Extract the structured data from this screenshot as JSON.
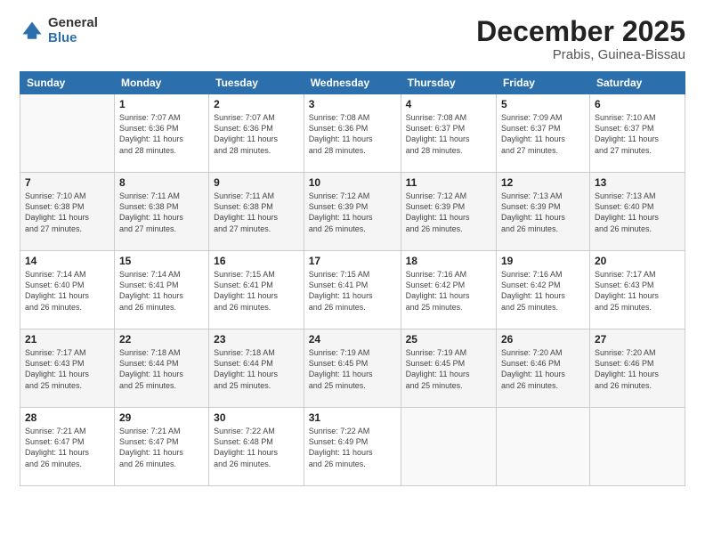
{
  "logo": {
    "general": "General",
    "blue": "Blue"
  },
  "title": "December 2025",
  "location": "Prabis, Guinea-Bissau",
  "days_of_week": [
    "Sunday",
    "Monday",
    "Tuesday",
    "Wednesday",
    "Thursday",
    "Friday",
    "Saturday"
  ],
  "weeks": [
    [
      {
        "day": "",
        "info": ""
      },
      {
        "day": "1",
        "info": "Sunrise: 7:07 AM\nSunset: 6:36 PM\nDaylight: 11 hours\nand 28 minutes."
      },
      {
        "day": "2",
        "info": "Sunrise: 7:07 AM\nSunset: 6:36 PM\nDaylight: 11 hours\nand 28 minutes."
      },
      {
        "day": "3",
        "info": "Sunrise: 7:08 AM\nSunset: 6:36 PM\nDaylight: 11 hours\nand 28 minutes."
      },
      {
        "day": "4",
        "info": "Sunrise: 7:08 AM\nSunset: 6:37 PM\nDaylight: 11 hours\nand 28 minutes."
      },
      {
        "day": "5",
        "info": "Sunrise: 7:09 AM\nSunset: 6:37 PM\nDaylight: 11 hours\nand 27 minutes."
      },
      {
        "day": "6",
        "info": "Sunrise: 7:10 AM\nSunset: 6:37 PM\nDaylight: 11 hours\nand 27 minutes."
      }
    ],
    [
      {
        "day": "7",
        "info": "Sunrise: 7:10 AM\nSunset: 6:38 PM\nDaylight: 11 hours\nand 27 minutes."
      },
      {
        "day": "8",
        "info": "Sunrise: 7:11 AM\nSunset: 6:38 PM\nDaylight: 11 hours\nand 27 minutes."
      },
      {
        "day": "9",
        "info": "Sunrise: 7:11 AM\nSunset: 6:38 PM\nDaylight: 11 hours\nand 27 minutes."
      },
      {
        "day": "10",
        "info": "Sunrise: 7:12 AM\nSunset: 6:39 PM\nDaylight: 11 hours\nand 26 minutes."
      },
      {
        "day": "11",
        "info": "Sunrise: 7:12 AM\nSunset: 6:39 PM\nDaylight: 11 hours\nand 26 minutes."
      },
      {
        "day": "12",
        "info": "Sunrise: 7:13 AM\nSunset: 6:39 PM\nDaylight: 11 hours\nand 26 minutes."
      },
      {
        "day": "13",
        "info": "Sunrise: 7:13 AM\nSunset: 6:40 PM\nDaylight: 11 hours\nand 26 minutes."
      }
    ],
    [
      {
        "day": "14",
        "info": "Sunrise: 7:14 AM\nSunset: 6:40 PM\nDaylight: 11 hours\nand 26 minutes."
      },
      {
        "day": "15",
        "info": "Sunrise: 7:14 AM\nSunset: 6:41 PM\nDaylight: 11 hours\nand 26 minutes."
      },
      {
        "day": "16",
        "info": "Sunrise: 7:15 AM\nSunset: 6:41 PM\nDaylight: 11 hours\nand 26 minutes."
      },
      {
        "day": "17",
        "info": "Sunrise: 7:15 AM\nSunset: 6:41 PM\nDaylight: 11 hours\nand 26 minutes."
      },
      {
        "day": "18",
        "info": "Sunrise: 7:16 AM\nSunset: 6:42 PM\nDaylight: 11 hours\nand 25 minutes."
      },
      {
        "day": "19",
        "info": "Sunrise: 7:16 AM\nSunset: 6:42 PM\nDaylight: 11 hours\nand 25 minutes."
      },
      {
        "day": "20",
        "info": "Sunrise: 7:17 AM\nSunset: 6:43 PM\nDaylight: 11 hours\nand 25 minutes."
      }
    ],
    [
      {
        "day": "21",
        "info": "Sunrise: 7:17 AM\nSunset: 6:43 PM\nDaylight: 11 hours\nand 25 minutes."
      },
      {
        "day": "22",
        "info": "Sunrise: 7:18 AM\nSunset: 6:44 PM\nDaylight: 11 hours\nand 25 minutes."
      },
      {
        "day": "23",
        "info": "Sunrise: 7:18 AM\nSunset: 6:44 PM\nDaylight: 11 hours\nand 25 minutes."
      },
      {
        "day": "24",
        "info": "Sunrise: 7:19 AM\nSunset: 6:45 PM\nDaylight: 11 hours\nand 25 minutes."
      },
      {
        "day": "25",
        "info": "Sunrise: 7:19 AM\nSunset: 6:45 PM\nDaylight: 11 hours\nand 25 minutes."
      },
      {
        "day": "26",
        "info": "Sunrise: 7:20 AM\nSunset: 6:46 PM\nDaylight: 11 hours\nand 26 minutes."
      },
      {
        "day": "27",
        "info": "Sunrise: 7:20 AM\nSunset: 6:46 PM\nDaylight: 11 hours\nand 26 minutes."
      }
    ],
    [
      {
        "day": "28",
        "info": "Sunrise: 7:21 AM\nSunset: 6:47 PM\nDaylight: 11 hours\nand 26 minutes."
      },
      {
        "day": "29",
        "info": "Sunrise: 7:21 AM\nSunset: 6:47 PM\nDaylight: 11 hours\nand 26 minutes."
      },
      {
        "day": "30",
        "info": "Sunrise: 7:22 AM\nSunset: 6:48 PM\nDaylight: 11 hours\nand 26 minutes."
      },
      {
        "day": "31",
        "info": "Sunrise: 7:22 AM\nSunset: 6:49 PM\nDaylight: 11 hours\nand 26 minutes."
      },
      {
        "day": "",
        "info": ""
      },
      {
        "day": "",
        "info": ""
      },
      {
        "day": "",
        "info": ""
      }
    ]
  ]
}
